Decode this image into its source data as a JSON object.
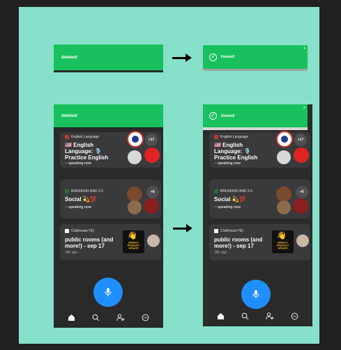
{
  "toast": {
    "left_text": "deleted!",
    "right_text": "Deleted!",
    "close_glyph": "×"
  },
  "rooms": [
    {
      "club": "English Language",
      "title": "🇺🇸 English Language: 🎙️ Practice English",
      "status": "speaking now",
      "count": "+17"
    },
    {
      "club": "BREAKING BAD 2.0",
      "title": "Social 💫💯",
      "status": "speaking now",
      "count": "+6"
    },
    {
      "club": "Clubhouse HQ",
      "title": "public rooms (and more!) - sep 17",
      "ago": "18h ago",
      "emoji": "👋",
      "poster": "WEEKLY PRODUCT UPDATE"
    }
  ],
  "nav": {
    "icons": [
      "home-icon",
      "search-icon",
      "add-user-icon",
      "messages-icon"
    ]
  },
  "colors": {
    "background": "#86e0ca",
    "toast": "#18c15d",
    "app_bg": "#2a2a2a",
    "card": "#3a3a3c",
    "mic": "#1f8fff"
  }
}
